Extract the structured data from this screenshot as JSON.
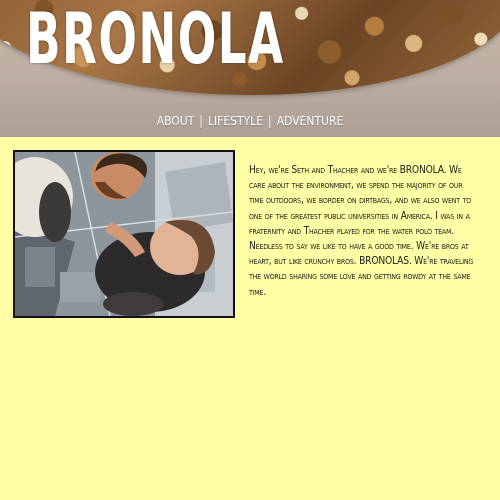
{
  "header": {
    "logo": "BRONOLA"
  },
  "nav": {
    "items": [
      {
        "label": "ABOUT"
      },
      {
        "label": "LIFESTYLE"
      },
      {
        "label": "ADVENTURE"
      }
    ],
    "separator": "|"
  },
  "photo": {
    "description_icon": "selfie-photo"
  },
  "about": {
    "text": "Hey, we're Seth and Thacher and we're BRONOLA. We care about the environment, we spend the majority of our time outdoors, we border on dirtbags, and we also went to one of the greatest public universities in America. I was in a fraternity and Thacher played for the water polo team. Needless to say we like to have a good time. We're bros at heart, but like crunchy bros. BRONOLAS. We're traveling the world sharing some love and getting rowdy at the same time."
  },
  "colors": {
    "page_background": "#ffffa6",
    "header_background": "#bdaea3",
    "logo_text": "#ffffff",
    "photo_border": "#111111"
  }
}
